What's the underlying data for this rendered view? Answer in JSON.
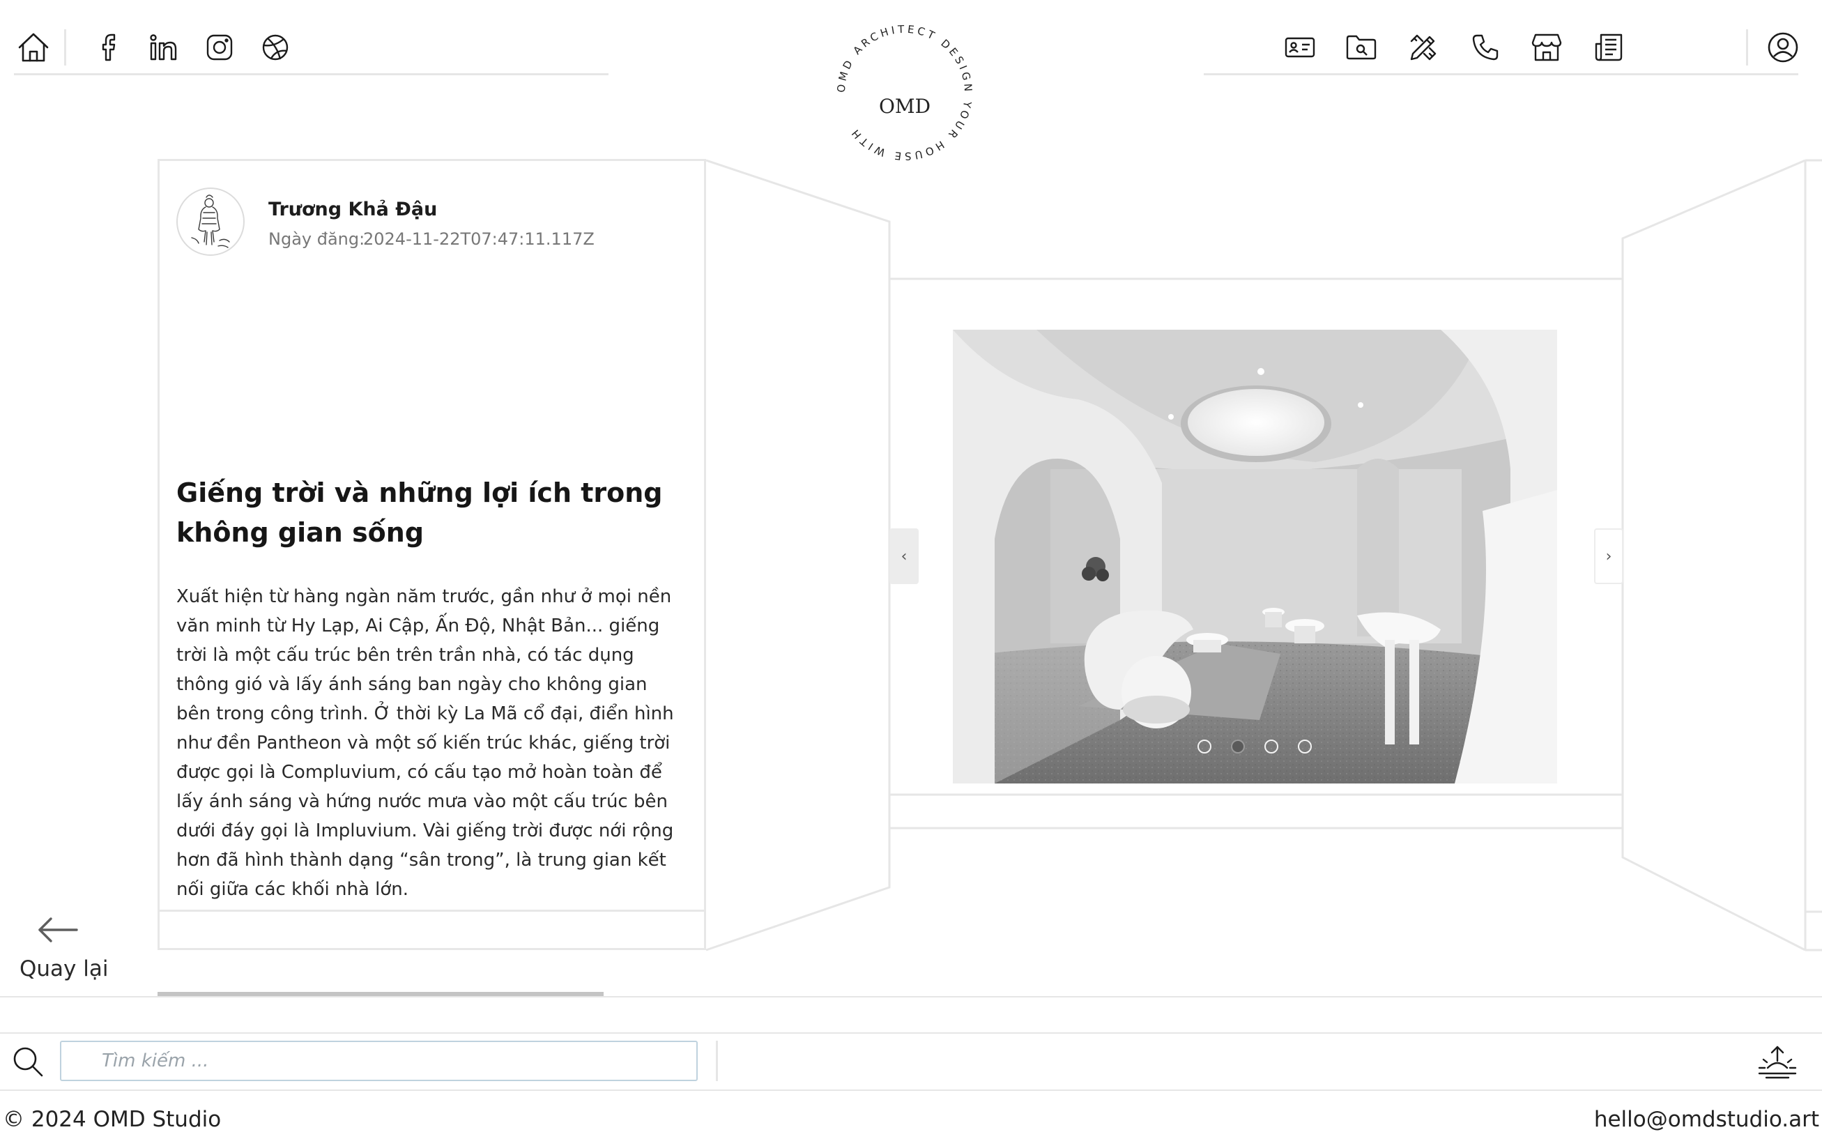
{
  "header": {
    "nav_left": [
      {
        "icon": "home-icon"
      },
      {
        "icon": "facebook-icon"
      },
      {
        "icon": "linkedin-icon"
      },
      {
        "icon": "instagram-icon"
      },
      {
        "icon": "dribbble-icon"
      }
    ],
    "logo": {
      "monogram": "OMD",
      "ring_text": "OMD ARCHITECT DESIGN YOUR HOUSE WITH "
    },
    "nav_right": [
      {
        "icon": "contact-card-icon"
      },
      {
        "icon": "folder-search-icon"
      },
      {
        "icon": "design-tools-icon"
      },
      {
        "icon": "phone-icon"
      },
      {
        "icon": "store-icon"
      },
      {
        "icon": "newspaper-icon"
      },
      {
        "icon": "account-icon"
      }
    ]
  },
  "article": {
    "author": "Trương Khả Đậu",
    "date_label": "Ngày đăng:",
    "date_value": "2024-11-22T07:47:11.117Z",
    "title": "Giếng trời và những lợi ích trong không gian sống",
    "body": "Xuất hiện từ hàng ngàn năm trước, gần như ở mọi nền văn minh từ Hy Lạp, Ai Cập, Ấn Độ, Nhật Bản... giếng trời là một cấu trúc bên trên trần nhà, có tác dụng thông gió và lấy ánh sáng ban ngày cho không gian bên trong công trình. Ở thời kỳ La Mã cổ đại, điển hình như đền Pantheon và một số kiến trúc khác, giếng trời được gọi là Compluvium, có cấu tạo mở hoàn toàn để lấy ánh sáng và hứng nước mưa vào một cấu trúc bên dưới đáy gọi là Impluvium. Vài giếng trời được nới rộng hơn đã hình thành dạng “sân trong”, là trung gian kết nối giữa các khối nhà lớn."
  },
  "gallery": {
    "prev_label": "‹",
    "next_label": "›",
    "slide_count": 4,
    "active_slide": 2
  },
  "back": {
    "label": "Quay lại"
  },
  "scroll_progress": 0.41,
  "footer": {
    "search_placeholder": "Tìm kiếm ...",
    "search_value": "",
    "copyright": "© 2024 OMD Studio",
    "email": "hello@omdstudio.art"
  },
  "colors": {
    "line": "#e6e6e6",
    "text": "#1b1b1b",
    "muted": "#777777",
    "search_border": "#bfd2de",
    "progress": "#c4c4c4"
  }
}
